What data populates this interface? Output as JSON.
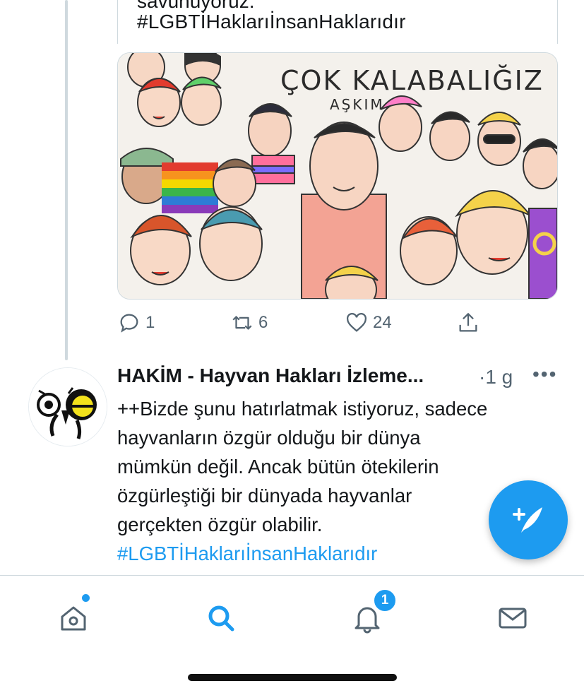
{
  "quoted": {
    "cut_text": "savunuyoruz.",
    "hashtag": "#LGBTİHaklarıİnsanHaklarıdır",
    "image": {
      "caption_main": "ÇOK KALABALIĞIZ",
      "caption_sub": "AŞKIM..."
    }
  },
  "tweet1_actions": {
    "reply_count": "1",
    "retweet_count": "6",
    "like_count": "24"
  },
  "tweet2": {
    "author": "HAKİM - Hayvan Hakları İzleme...",
    "time": "·1 g",
    "more": "•••",
    "line1": "++Bizde şunu hatırlatmak istiyoruz, sadece",
    "line2": "hayvanların özgür olduğu bir dünya",
    "line3": "mümkün değil. Ancak bütün ötekilerin",
    "line4": "özgürleştiği bir dünyada hayvanlar",
    "line5": "gerçekten özgür olabilir.",
    "hashtag": "#LGBTİHaklarıİnsanHaklarıdır"
  },
  "tabbar": {
    "notifications_badge": "1"
  },
  "colors": {
    "accent": "#1d9bf0",
    "secondary_text": "#536471",
    "border": "#cfd9de"
  },
  "icons": [
    "reply-icon",
    "retweet-icon",
    "like-icon",
    "share-icon",
    "compose-tweet-icon",
    "home-icon",
    "search-icon",
    "notifications-icon",
    "messages-icon"
  ]
}
